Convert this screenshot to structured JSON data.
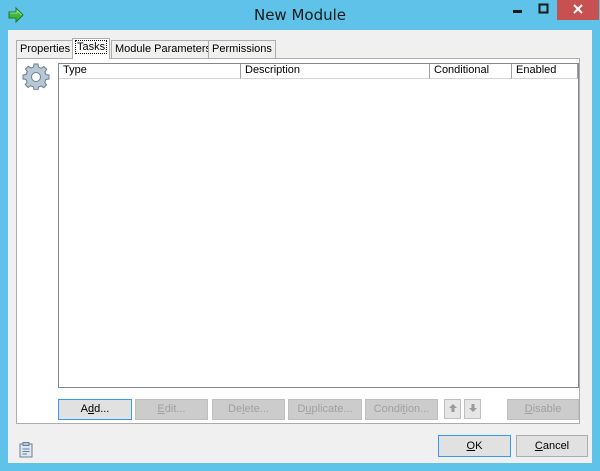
{
  "window": {
    "title": "New Module"
  },
  "tabs": [
    {
      "label": "Properties",
      "active": false
    },
    {
      "label": "Tasks",
      "active": true
    },
    {
      "label": "Module Parameters",
      "active": false
    },
    {
      "label": "Permissions",
      "active": false
    }
  ],
  "grid": {
    "columns": [
      "Type",
      "Description",
      "Conditional",
      "Enabled"
    ],
    "rows": []
  },
  "actions": {
    "add": {
      "pre": "A",
      "ul": "d",
      "post": "d..."
    },
    "edit": {
      "pre": "",
      "ul": "E",
      "post": "dit..."
    },
    "delete": {
      "pre": "De",
      "ul": "l",
      "post": "ete..."
    },
    "duplicate": {
      "pre": "D",
      "ul": "u",
      "post": "plicate..."
    },
    "condition": {
      "pre": "Condi",
      "ul": "t",
      "post": "ion..."
    },
    "disable": {
      "pre": "",
      "ul": "D",
      "post": "isable"
    }
  },
  "dialog_buttons": {
    "ok": {
      "pre": "",
      "ul": "O",
      "post": "K"
    },
    "cancel": {
      "pre": "",
      "ul": "C",
      "post": "ancel"
    }
  },
  "colors": {
    "titlebar": "#5fc2e8",
    "close_button": "#c75050",
    "dialog_bg": "#f0f0f0",
    "focus_border": "#3399ff"
  },
  "icons": {
    "app": "green-right-arrow-icon",
    "tasks_panel": "gear-icon",
    "move_up": "up-arrow-icon",
    "move_down": "down-arrow-icon",
    "footer": "clipboard-icon"
  }
}
